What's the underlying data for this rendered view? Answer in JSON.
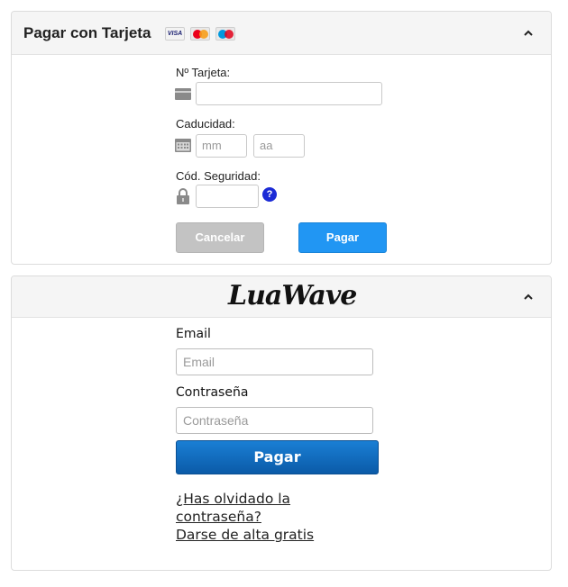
{
  "card_panel": {
    "title": "Pagar con Tarjeta",
    "brands": [
      "VISA",
      "MasterCard",
      "Maestro"
    ],
    "card_number_label": "Nº Tarjeta:",
    "card_number_value": "",
    "expiry_label": "Caducidad:",
    "month_placeholder": "mm",
    "year_placeholder": "aa",
    "cvv_label": "Cód. Seguridad:",
    "cvv_value": "",
    "help_icon_text": "?",
    "cancel_label": "Cancelar",
    "pay_label": "Pagar"
  },
  "wallet_panel": {
    "logo_text": "LuaWave",
    "email_label": "Email",
    "email_placeholder": "Email",
    "password_label": "Contraseña",
    "password_placeholder": "Contraseña",
    "pay_label": "Pagar",
    "forgot_line1": "¿Has olvidado la",
    "forgot_line2": "contraseña?",
    "signup_label": "Darse de alta gratis"
  },
  "colors": {
    "pay_blue": "#2196f3",
    "pay_dark_blue": "#0b5ba8",
    "cancel_gray": "#c3c3c3",
    "help_blue": "#1b2bd6"
  },
  "icons": [
    "chevron-up-icon",
    "credit-card-icon",
    "calendar-icon",
    "lock-icon",
    "help-icon"
  ]
}
